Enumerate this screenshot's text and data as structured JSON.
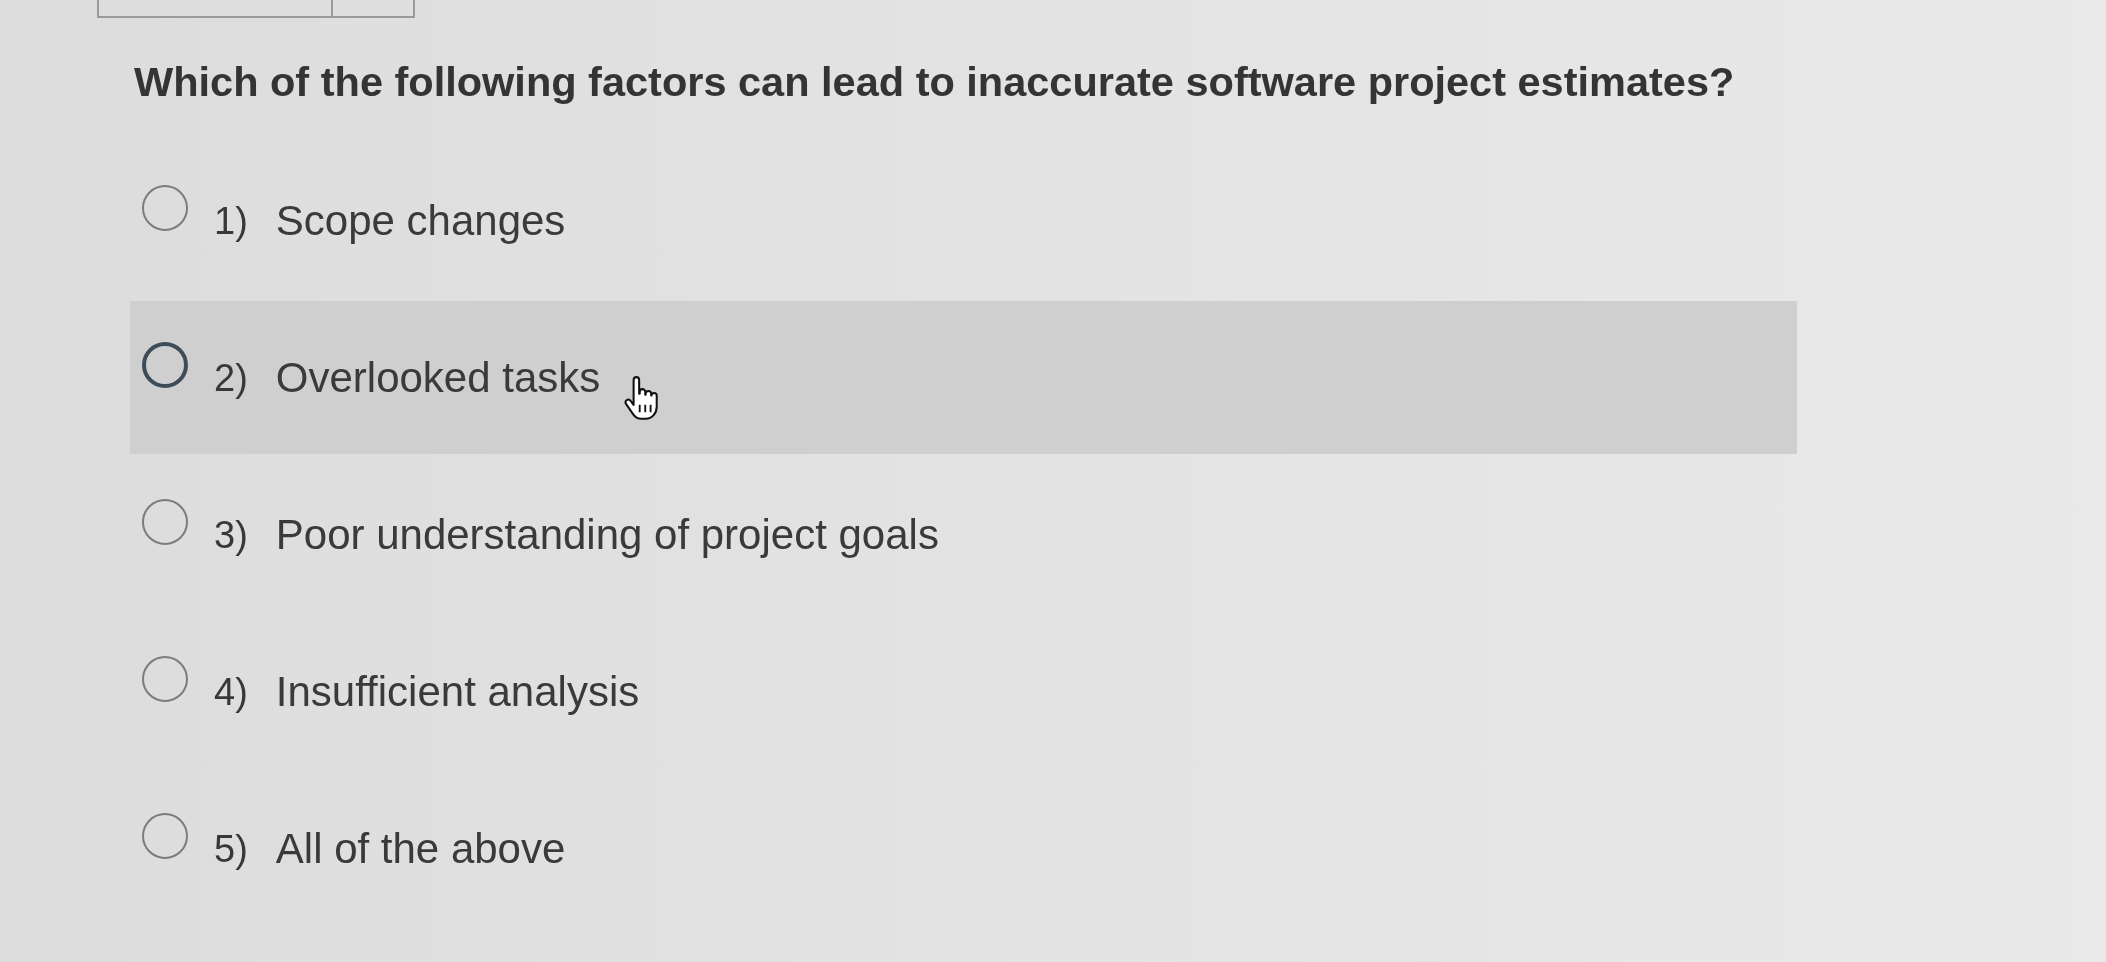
{
  "question": {
    "text": "Which of the following factors can lead to inaccurate software project estimates?"
  },
  "options": [
    {
      "number": "1)",
      "label": "Scope changes",
      "selected": false,
      "hovered": false
    },
    {
      "number": "2)",
      "label": "Overlooked tasks",
      "selected": false,
      "hovered": true
    },
    {
      "number": "3)",
      "label": "Poor understanding of project goals",
      "selected": false,
      "hovered": false
    },
    {
      "number": "4)",
      "label": "Insufficient analysis",
      "selected": false,
      "hovered": false
    },
    {
      "number": "5)",
      "label": "All of the above",
      "selected": false,
      "hovered": false
    }
  ]
}
